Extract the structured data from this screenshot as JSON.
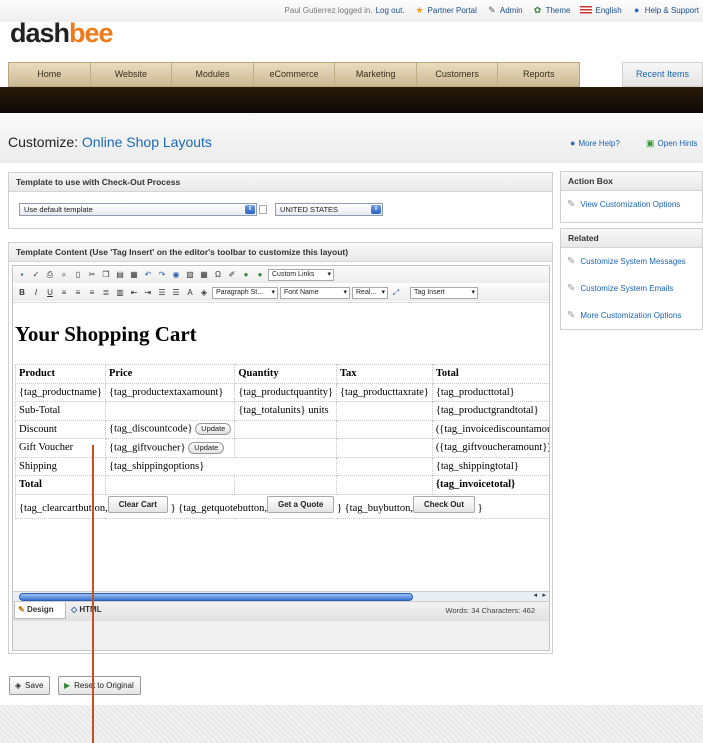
{
  "header": {
    "logo_part1": "dash",
    "logo_part2": "bee",
    "login_text": "Paul Gutierrez logged in.",
    "logout": "Log out.",
    "links": [
      {
        "label": "Partner Portal",
        "icon": "star-icon"
      },
      {
        "label": "Admin",
        "icon": "wrench-icon"
      },
      {
        "label": "Theme",
        "icon": "palette-icon"
      },
      {
        "label": "English",
        "icon": "flag-icon"
      },
      {
        "label": "Help & Support",
        "icon": "help-bubble-icon"
      }
    ]
  },
  "nav": {
    "tabs": [
      "Home",
      "Website",
      "Modules",
      "eCommerce",
      "Marketing",
      "Customers",
      "Reports"
    ],
    "recent": "Recent Items"
  },
  "page": {
    "title_prefix": "Customize:",
    "title": "Online Shop Layouts",
    "more_help": "More Help?",
    "open_hints": "Open Hints"
  },
  "template_panel": {
    "title": "Template to use with Check-Out Process",
    "template_select": "Use default template",
    "country_select": "UNITED STATES"
  },
  "content_panel": {
    "title": "Template Content (Use 'Tag Insert' on the editor's toolbar to customize this layout)",
    "toolbar": {
      "custom_links": "Custom Links",
      "paragraph_style": "Paragraph St...",
      "font_name": "Font Name",
      "font_size": "Real...",
      "tag_insert": "Tag Insert"
    },
    "document": {
      "heading": "Your Shopping Cart",
      "columns": [
        "Product",
        "Price",
        "Quantity",
        "Tax",
        "Total"
      ],
      "rows": [
        [
          "{tag_productname}",
          "{tag_productextaxamount}",
          "{tag_productquantity}",
          "{tag_producttaxrate}",
          "{tag_producttotal}"
        ],
        [
          "Sub-Total",
          "",
          "{tag_totalunits} units",
          "",
          "{tag_productgrandtotal}"
        ],
        [
          "Discount",
          "{tag_discountcode}",
          "",
          "",
          "({tag_invoicediscountamount})"
        ],
        [
          "Gift Voucher",
          "{tag_giftvoucher}",
          "",
          "",
          "({tag_giftvoucheramount})"
        ],
        [
          "Shipping",
          "{tag_shippingoptions}",
          "",
          "",
          "{tag_shippingtotal}"
        ],
        [
          "Total",
          "",
          "",
          "",
          "{tag_invoicetotal}"
        ]
      ],
      "update_label": "Update",
      "clear_cart_tag": "{tag_clearcartbutton,",
      "clear_cart_btn": "Clear Cart",
      "get_quote_tag": "} {tag_getquotebutton,",
      "get_quote_btn": "Get a Quote",
      "buy_tag": "} {tag_buybutton,",
      "buy_btn": "Check Out",
      "close_brace": "}"
    },
    "mode_design": "Design",
    "mode_html": "HTML",
    "word_count": "Words: 34   Characters: 462"
  },
  "sidebar": {
    "action_box_title": "Action Box",
    "action_links": [
      "View Customization Options"
    ],
    "related_title": "Related",
    "related_links": [
      "Customize System Messages",
      "Customize System Emails",
      "More Customization Options"
    ]
  },
  "footer": {
    "save": "Save",
    "reset": "Reset to Original"
  }
}
